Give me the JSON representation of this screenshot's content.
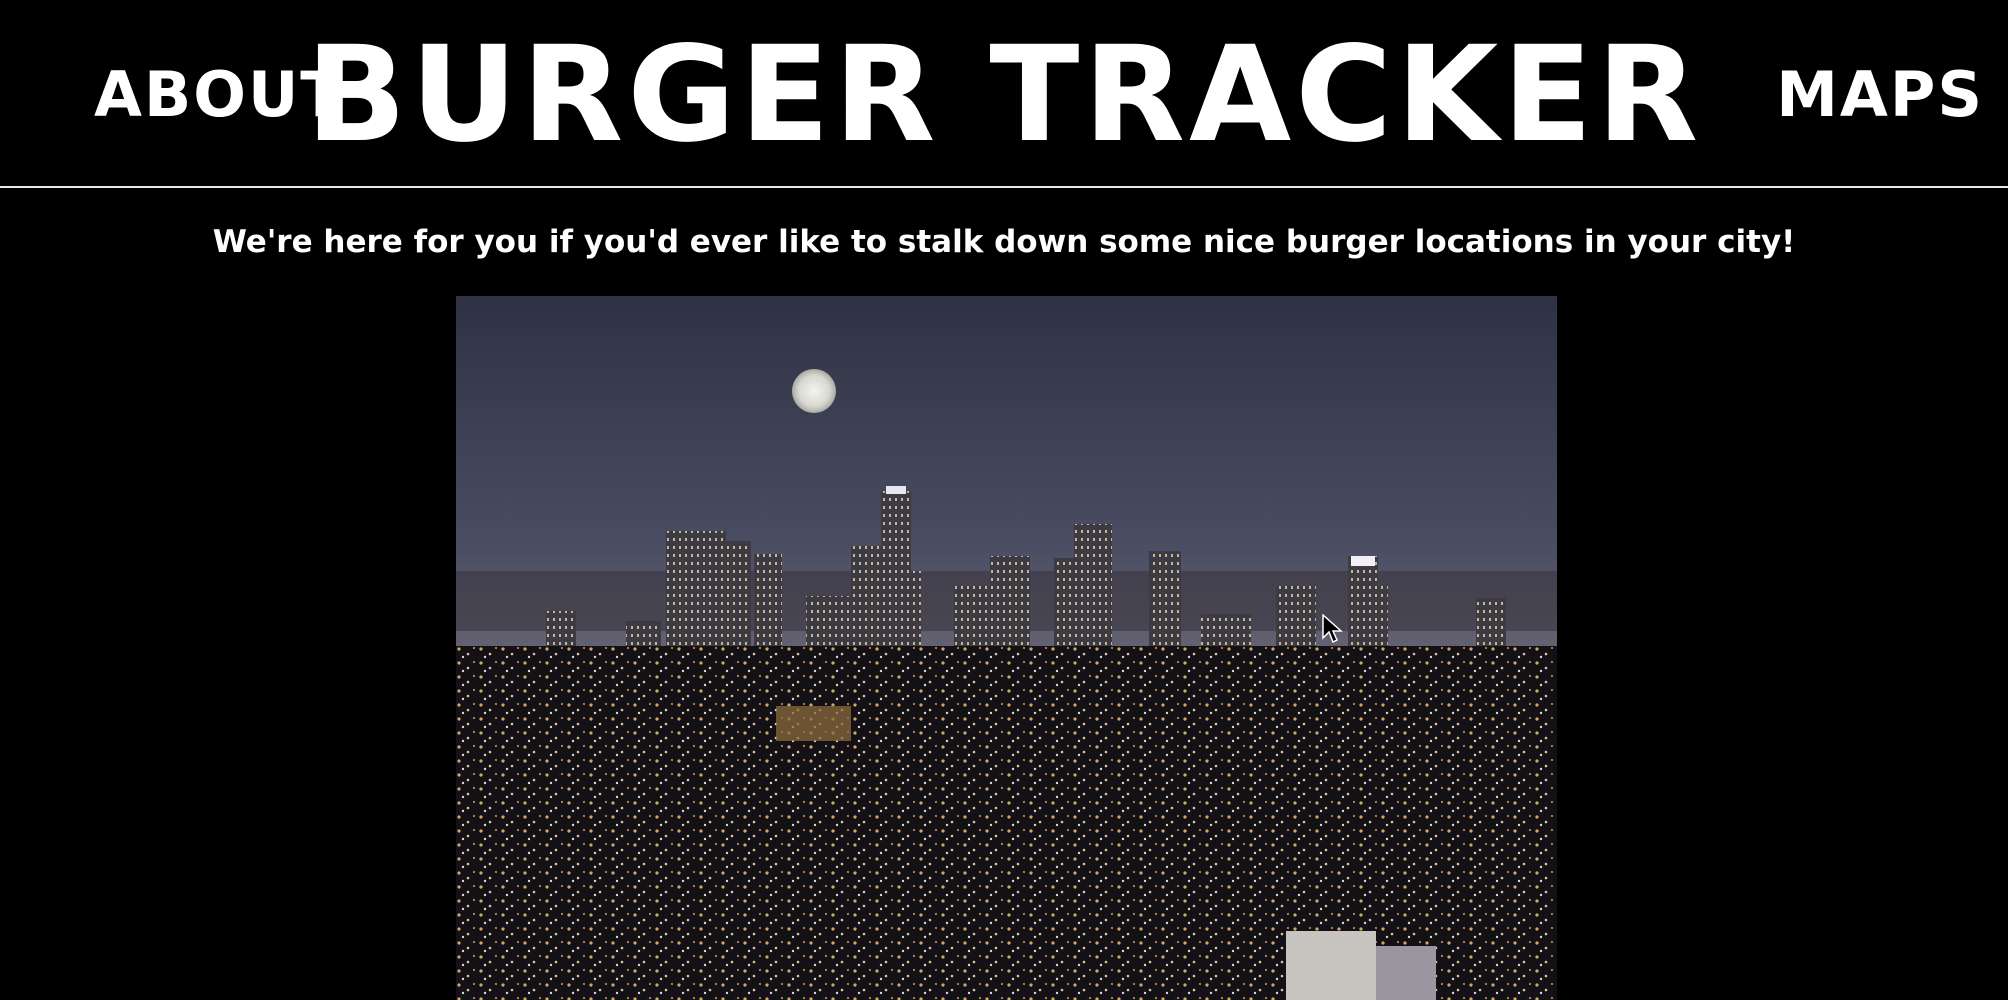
{
  "nav": {
    "about_label": "ABOUT",
    "maps_label": "MAPS"
  },
  "header": {
    "title": "BURGER TRACKER"
  },
  "main": {
    "tagline": "We're here for you if you'd ever like to stalk down some nice burger locations in your city!",
    "hero_image": {
      "icon": "city-skyline-night-image"
    }
  },
  "colors": {
    "background": "#000000",
    "text": "#ffffff",
    "divider": "#e8e8e8"
  }
}
